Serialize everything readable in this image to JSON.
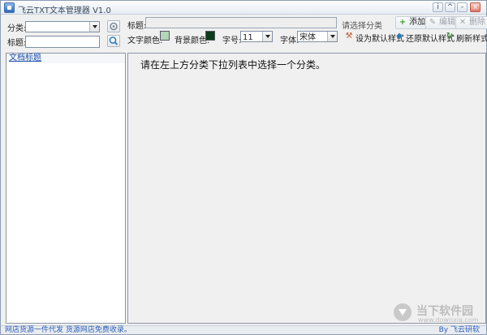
{
  "app": {
    "title": "飞云TXT文本管理器 V1.0",
    "icon": "app-window-icon"
  },
  "window_controls": {
    "info": "i",
    "minimize_up": "^",
    "minimize": "-",
    "close": "x"
  },
  "left_panel": {
    "category_label": "分类:",
    "category_value": "",
    "title_label": "标题:",
    "title_value": "",
    "settings_icon": "gear-icon",
    "search_icon": "search-icon",
    "doc_list_header": "文档标题"
  },
  "toolbar": {
    "title_label": "标题:",
    "title_value": "",
    "hint": "请选择分类",
    "add_label": "添加",
    "edit_label": "编辑",
    "delete_label": "删除",
    "text_color_label": "文字颜色:",
    "text_color": "#b3d6b6",
    "bg_color_label": "背景颜色:",
    "bg_color": "#0b3d1a",
    "font_size_label": "字号:",
    "font_size_value": "11",
    "font_label": "字体:",
    "font_value": "宋体",
    "set_default_label": "设为默认样式",
    "restore_default_label": "还原默认样式",
    "refresh_label": "刷新样式"
  },
  "editor": {
    "message": "请在左上方分类下拉列表中选择一个分类。"
  },
  "status": {
    "left": "网店货源一件代发 货源网店免费收录。",
    "right": "By 飞云研软"
  },
  "watermark": {
    "name": "当下软件园",
    "url": "www.downxia.com"
  }
}
